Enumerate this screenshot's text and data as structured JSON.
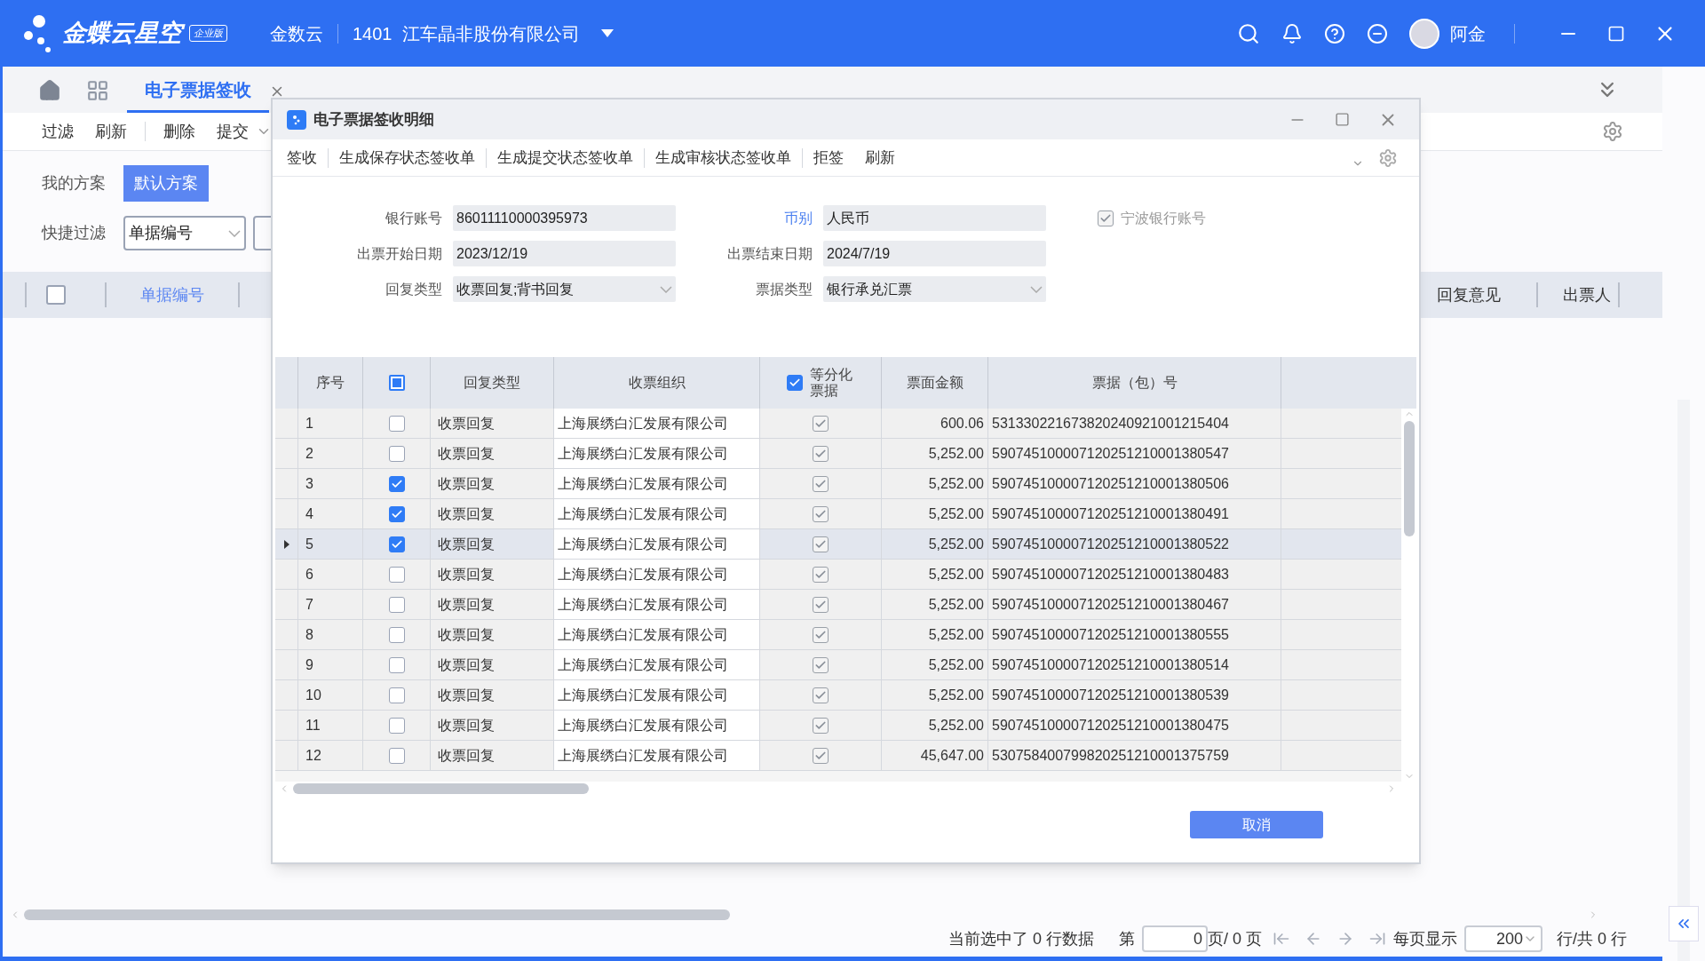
{
  "app_bar": {
    "logo": "金蝶云星空",
    "edition": "企业版",
    "product": "金数云",
    "company": "1401  江车晶非股份有限公司",
    "user": "阿金"
  },
  "tabs": [
    {
      "label": "电子票据签收",
      "selected": true
    }
  ],
  "toolbar": [
    {
      "label": "过滤",
      "menu": false
    },
    {
      "label": "刷新",
      "menu": false
    },
    {
      "label": "删除",
      "menu": false
    },
    {
      "label": "提交",
      "menu": true
    }
  ],
  "schemes": {
    "label": "我的方案",
    "items": [
      {
        "label": "默认方案",
        "selected": true
      }
    ]
  },
  "quick_filter": {
    "label": "快捷过滤",
    "field": "单据编号"
  },
  "list_columns": [
    "单据编号",
    "回复意见",
    "出票人"
  ],
  "list_select_all": false,
  "pager": {
    "selected_info": "当前选中了 0 行数据",
    "page_prefix": "第",
    "page": "0",
    "page_suffix": "页/ 0 页",
    "per_page_label": "每页显示",
    "per_page": "200",
    "total": "行/共 0 行"
  },
  "dialog": {
    "title": "电子票据签收明细",
    "toolbar": [
      "签收",
      "生成保存状态签收单",
      "生成提交状态签收单",
      "生成审核状态签收单",
      "拒签",
      "刷新"
    ],
    "form": [
      {
        "label": "银行账号",
        "value": "86011110000395973",
        "kind": "text",
        "link": false
      },
      {
        "label": "币别",
        "value": "人民币",
        "kind": "text",
        "link": true
      },
      {
        "label": "出票开始日期",
        "value": "2023/12/19",
        "kind": "text",
        "link": false
      },
      {
        "label": "出票结束日期",
        "value": "2024/7/19",
        "kind": "text",
        "link": false
      },
      {
        "label": "回复类型",
        "value": "收票回复;背书回复",
        "kind": "select",
        "link": false
      },
      {
        "label": "票据类型",
        "value": "银行承兑汇票",
        "kind": "select",
        "link": false
      }
    ],
    "ningbo": {
      "label": "宁波银行账号",
      "checked": true
    },
    "table": {
      "columns": [
        "序号",
        "回复类型",
        "收票组织",
        "等分化票据",
        "票面金额",
        "票据（包）号"
      ],
      "header_partial": true,
      "equal_check": true,
      "rows": [
        {
          "no": "1",
          "selected": false,
          "current": false,
          "reply": "收票回复",
          "org": "上海展绣白汇发展有限公司",
          "equal": true,
          "amount": "600.06",
          "bill": "531330221673820240921001215404"
        },
        {
          "no": "2",
          "selected": false,
          "current": false,
          "reply": "收票回复",
          "org": "上海展绣白汇发展有限公司",
          "equal": true,
          "amount": "5,252.00",
          "bill": "590745100007120251210001380547"
        },
        {
          "no": "3",
          "selected": true,
          "current": false,
          "reply": "收票回复",
          "org": "上海展绣白汇发展有限公司",
          "equal": true,
          "amount": "5,252.00",
          "bill": "590745100007120251210001380506"
        },
        {
          "no": "4",
          "selected": true,
          "current": false,
          "reply": "收票回复",
          "org": "上海展绣白汇发展有限公司",
          "equal": true,
          "amount": "5,252.00",
          "bill": "590745100007120251210001380491"
        },
        {
          "no": "5",
          "selected": true,
          "current": true,
          "reply": "收票回复",
          "org": "上海展绣白汇发展有限公司",
          "equal": true,
          "amount": "5,252.00",
          "bill": "590745100007120251210001380522"
        },
        {
          "no": "6",
          "selected": false,
          "current": false,
          "reply": "收票回复",
          "org": "上海展绣白汇发展有限公司",
          "equal": true,
          "amount": "5,252.00",
          "bill": "590745100007120251210001380483"
        },
        {
          "no": "7",
          "selected": false,
          "current": false,
          "reply": "收票回复",
          "org": "上海展绣白汇发展有限公司",
          "equal": true,
          "amount": "5,252.00",
          "bill": "590745100007120251210001380467"
        },
        {
          "no": "8",
          "selected": false,
          "current": false,
          "reply": "收票回复",
          "org": "上海展绣白汇发展有限公司",
          "equal": true,
          "amount": "5,252.00",
          "bill": "590745100007120251210001380555"
        },
        {
          "no": "9",
          "selected": false,
          "current": false,
          "reply": "收票回复",
          "org": "上海展绣白汇发展有限公司",
          "equal": true,
          "amount": "5,252.00",
          "bill": "590745100007120251210001380514"
        },
        {
          "no": "10",
          "selected": false,
          "current": false,
          "reply": "收票回复",
          "org": "上海展绣白汇发展有限公司",
          "equal": true,
          "amount": "5,252.00",
          "bill": "590745100007120251210001380539"
        },
        {
          "no": "11",
          "selected": false,
          "current": false,
          "reply": "收票回复",
          "org": "上海展绣白汇发展有限公司",
          "equal": true,
          "amount": "5,252.00",
          "bill": "590745100007120251210001380475"
        },
        {
          "no": "12",
          "selected": false,
          "current": false,
          "reply": "收票回复",
          "org": "上海展绣白汇发展有限公司",
          "equal": true,
          "amount": "45,647.00",
          "bill": "530758400799820251210001375759"
        }
      ]
    },
    "cancel": "取消"
  }
}
